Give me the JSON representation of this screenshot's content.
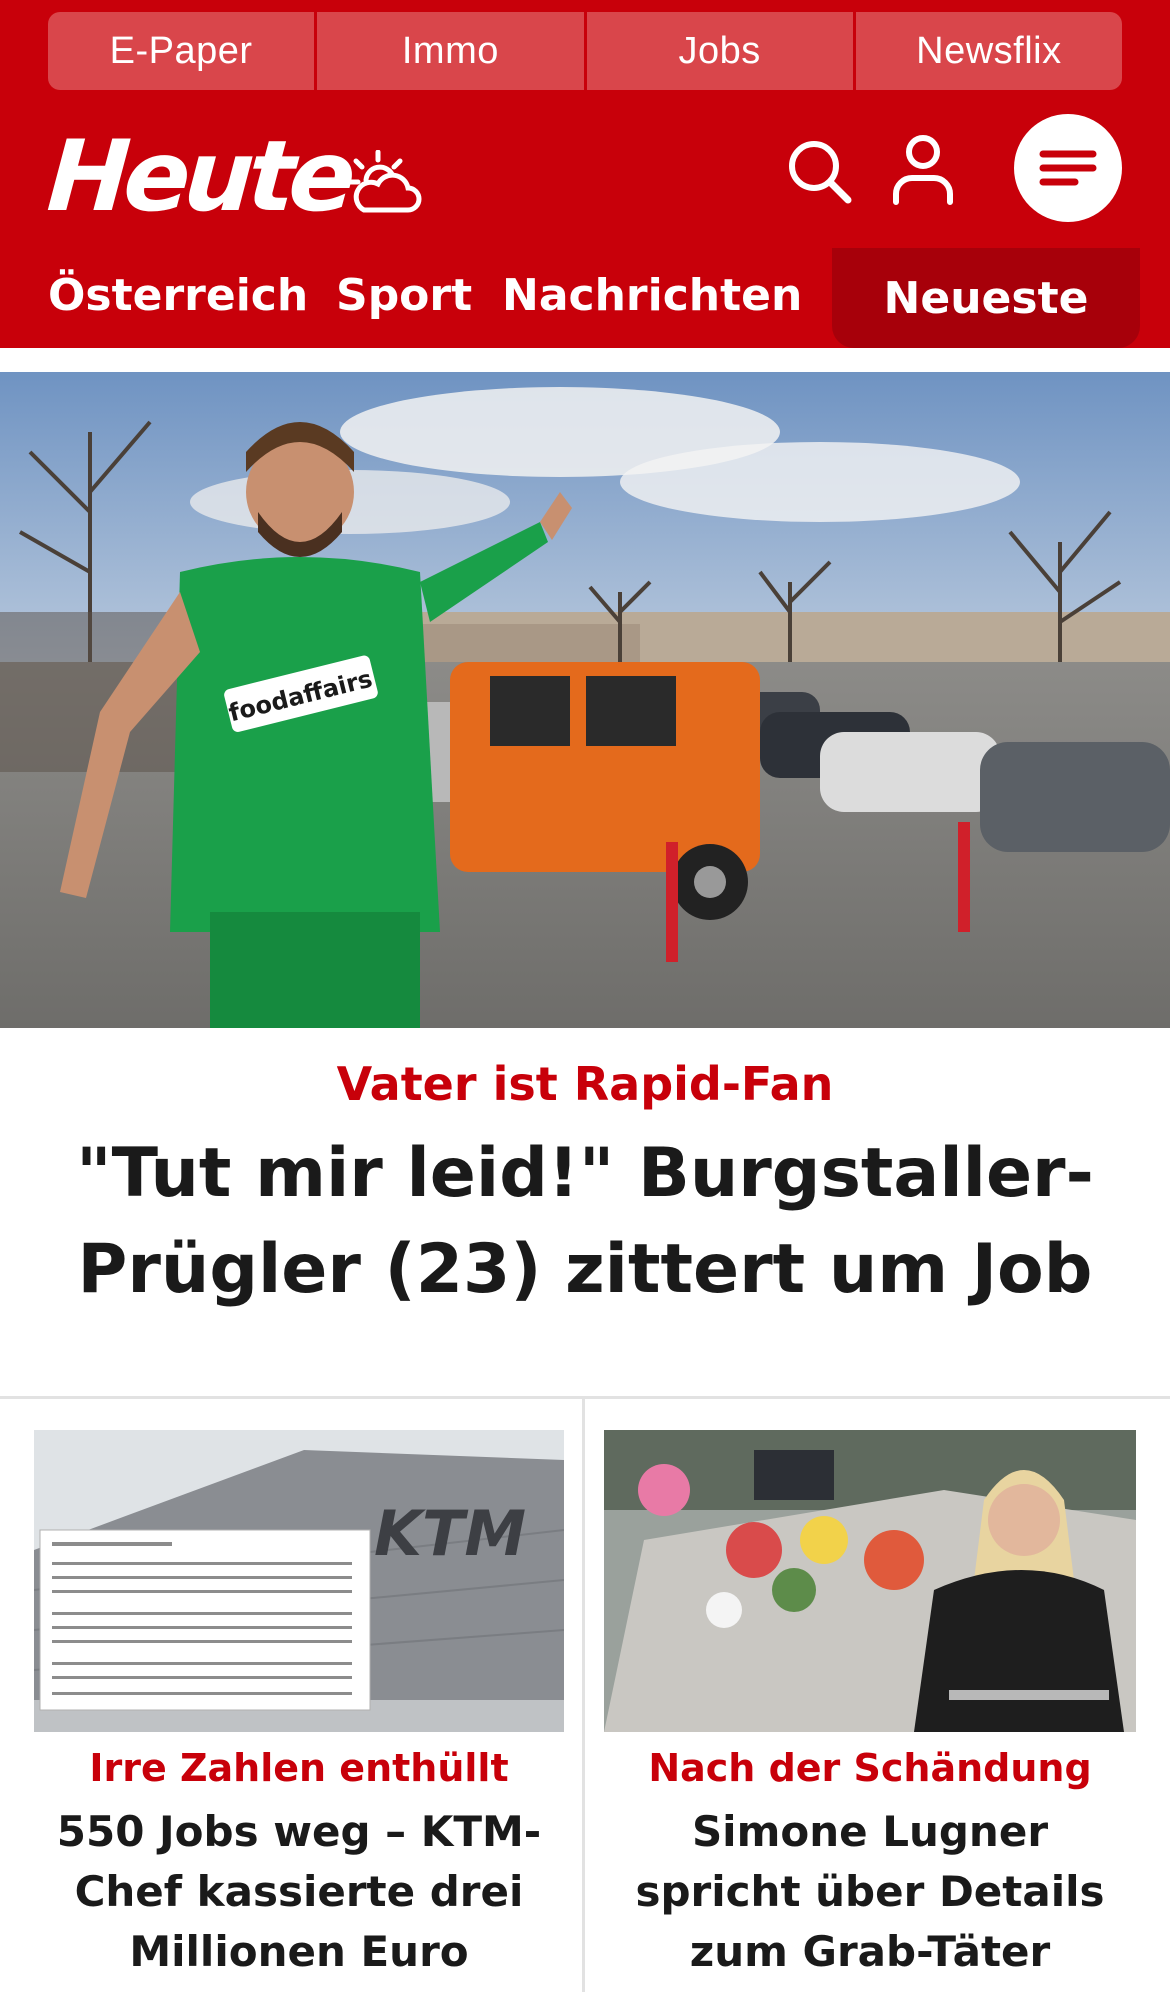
{
  "colors": {
    "brand_red": "#c8000a",
    "brand_red_dark": "#a7000a",
    "toplink_bg": "#d9464b",
    "text_dark": "#1a1a1a"
  },
  "toplinks": [
    "E-Paper",
    "Immo",
    "Jobs",
    "Newsflix"
  ],
  "brand": {
    "logo": "Heute",
    "weather_icon": "partly-cloudy-icon"
  },
  "header_icons": {
    "search": "search-icon",
    "account": "user-icon",
    "menu": "menu-icon"
  },
  "nav": {
    "items": [
      "Österreich",
      "Sport",
      "Nachrichten"
    ],
    "active": "Neueste"
  },
  "hero": {
    "jersey_text": "foodaffairs",
    "kicker": "Vater ist Rapid-Fan",
    "title": "\"Tut mir leid!\" Burgstaller-Prügler (23) zittert um Job"
  },
  "cards": [
    {
      "image_text": "KTM",
      "kicker": "Irre Zahlen enthüllt",
      "title": "550 Jobs weg – KTM-Chef kassierte drei Millionen Euro"
    },
    {
      "kicker": "Nach der Schändung",
      "title": "Simone Lugner spricht über Details zum Grab-Täter"
    }
  ]
}
